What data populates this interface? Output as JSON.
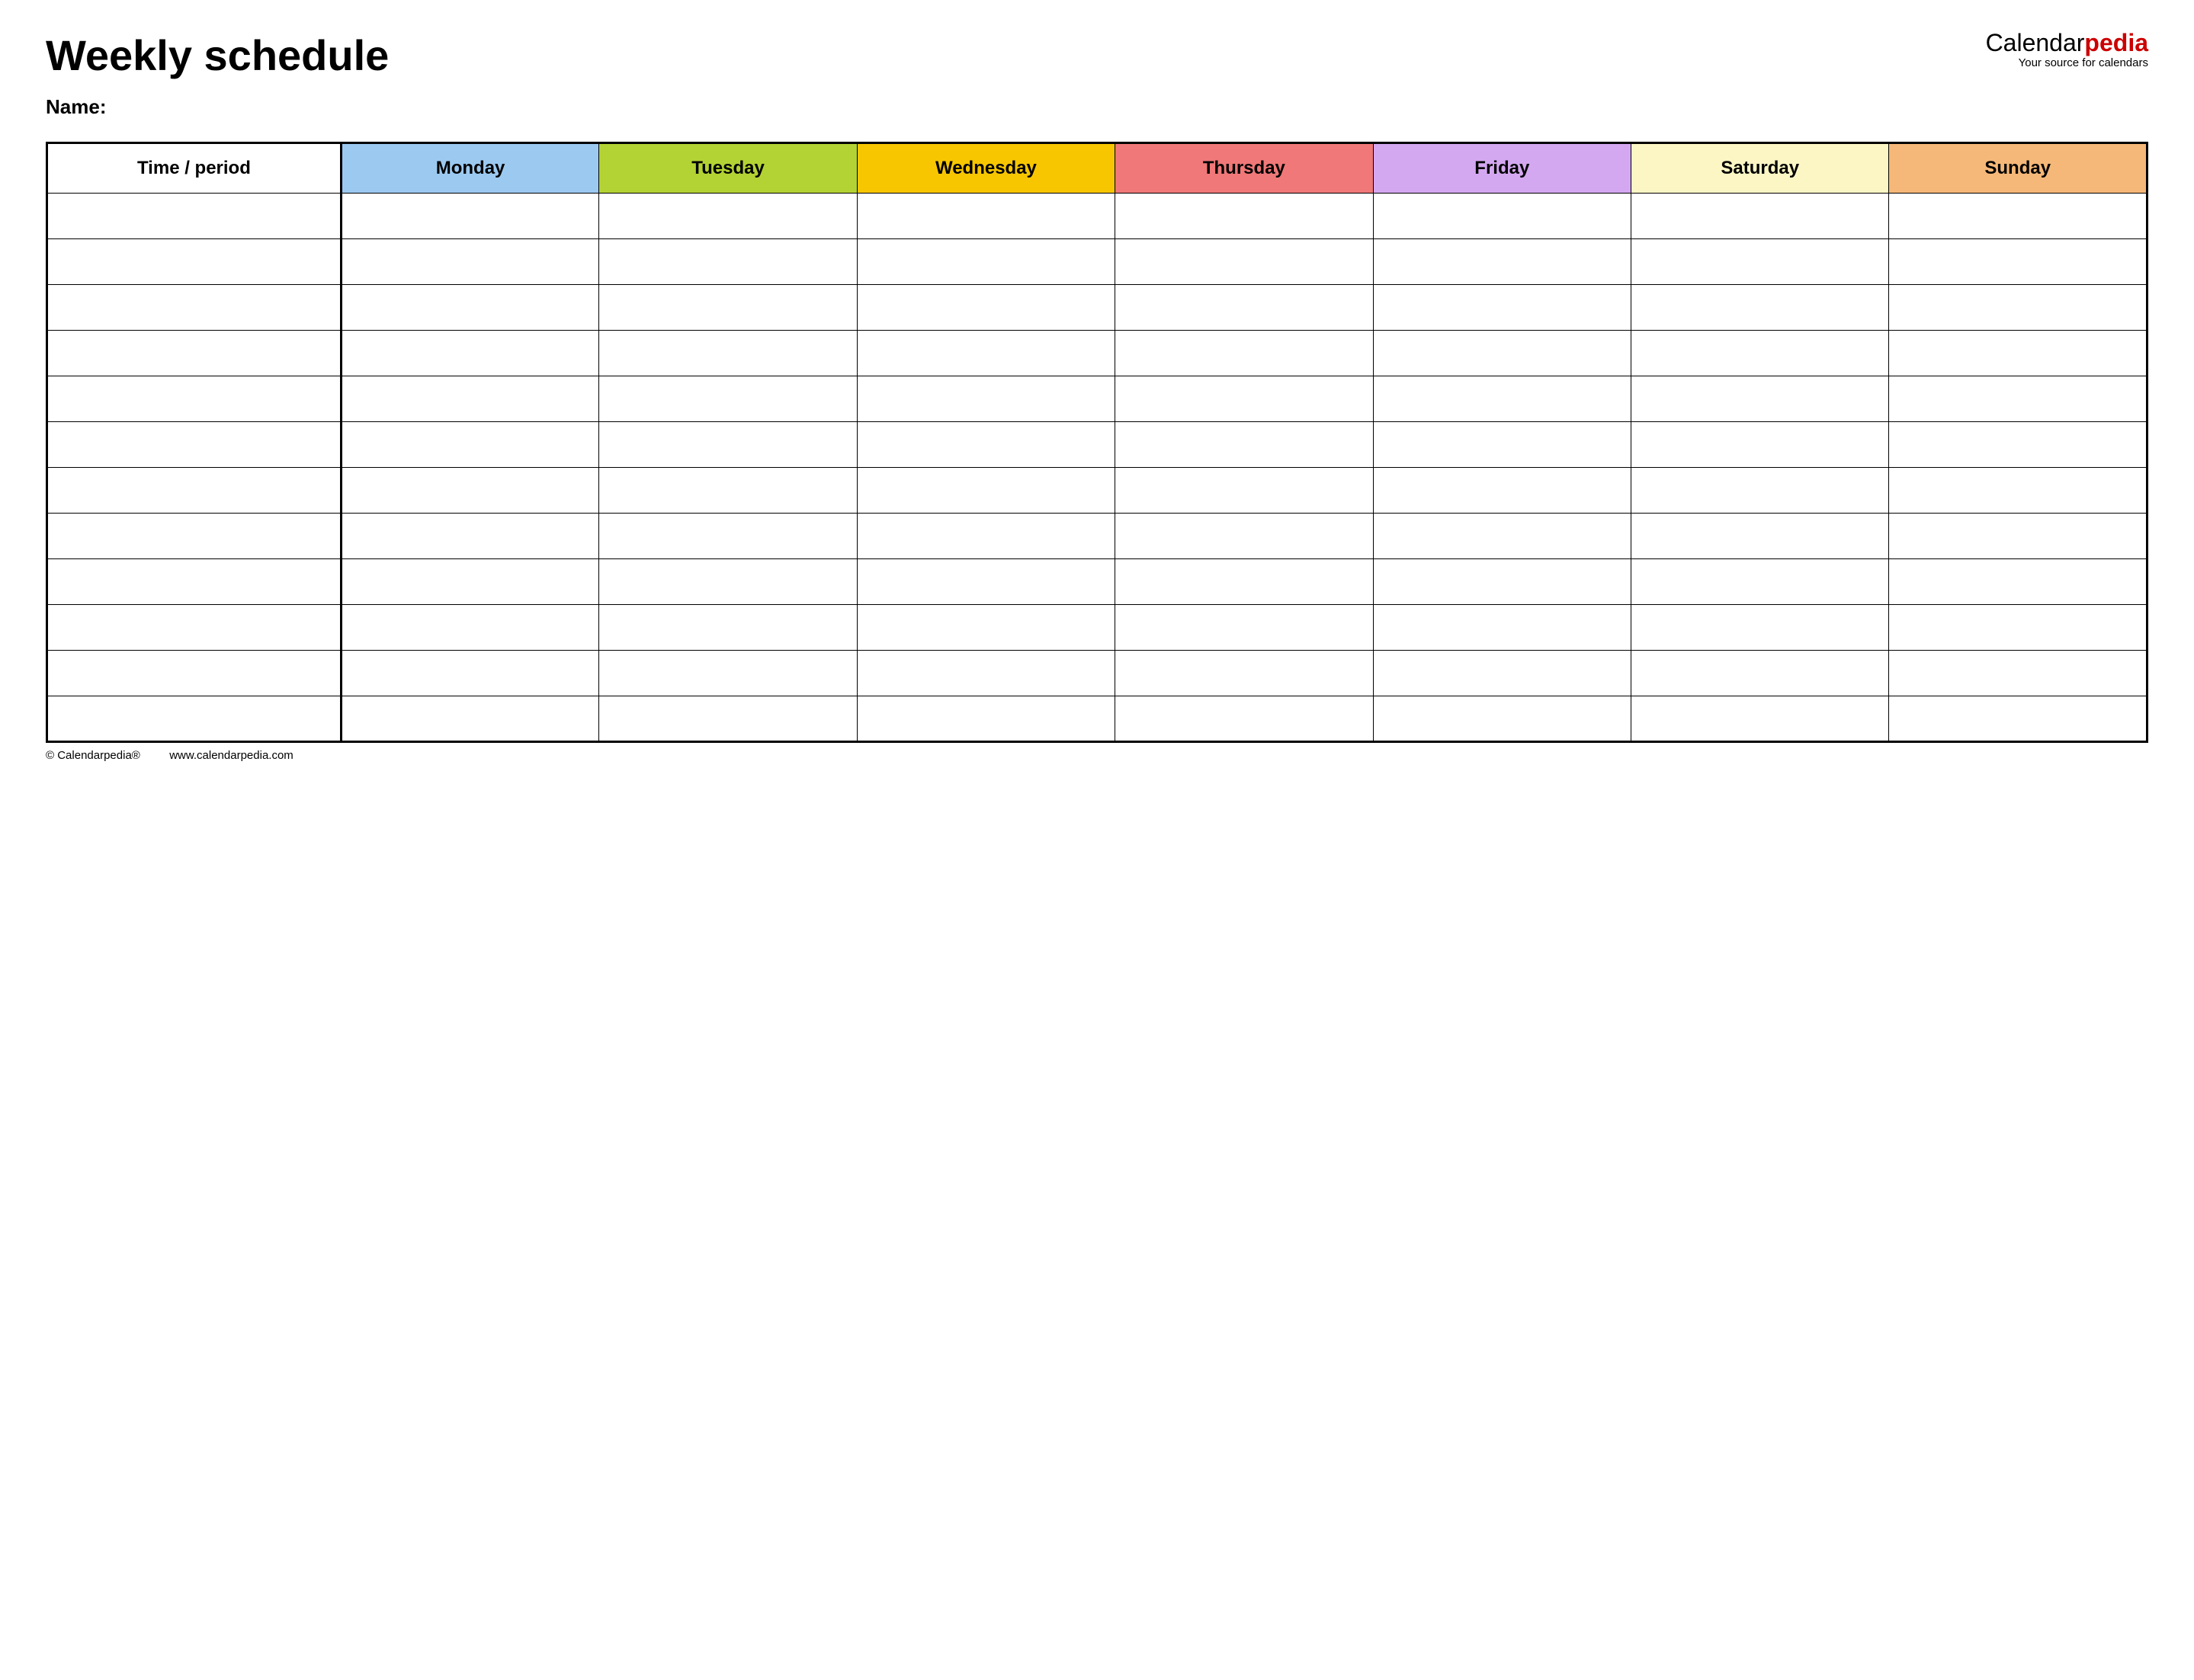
{
  "header": {
    "title": "Weekly schedule",
    "brand_prefix": "Calendar",
    "brand_suffix": "pedia",
    "tagline": "Your source for calendars"
  },
  "name_label": "Name:",
  "columns": {
    "time": "Time / period",
    "monday": "Monday",
    "tuesday": "Tuesday",
    "wednesday": "Wednesday",
    "thursday": "Thursday",
    "friday": "Friday",
    "saturday": "Saturday",
    "sunday": "Sunday"
  },
  "row_count": 12,
  "footer": {
    "copyright": "© Calendarpedia®",
    "url": "www.calendarpedia.com"
  },
  "colors": {
    "monday": "#9cc9f0",
    "tuesday": "#b3d334",
    "wednesday": "#f7c600",
    "thursday": "#f07878",
    "friday": "#d4a8f0",
    "saturday": "#fbf6c4",
    "sunday": "#f5b878"
  }
}
